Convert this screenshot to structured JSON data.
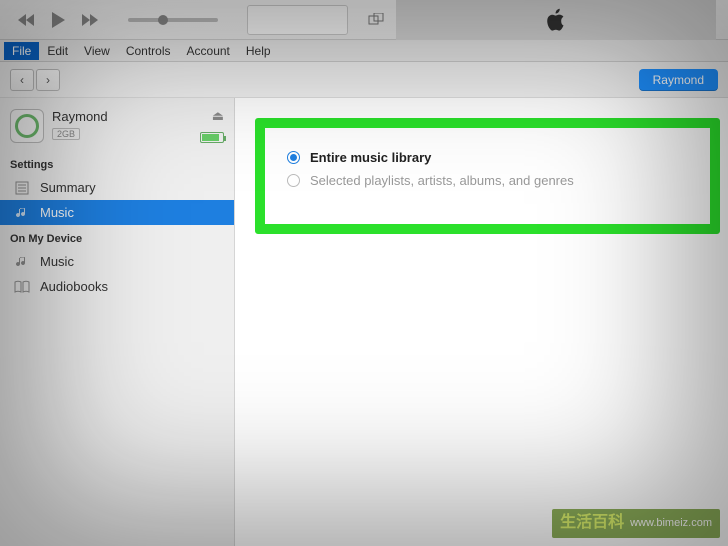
{
  "menubar": {
    "file": "File",
    "edit": "Edit",
    "view": "View",
    "controls": "Controls",
    "account": "Account",
    "help": "Help"
  },
  "nav": {
    "back": "‹",
    "forward": "›",
    "user_button": "Raymond"
  },
  "device": {
    "name": "Raymond",
    "capacity": "2GB",
    "eject_glyph": "⏏"
  },
  "sidebar": {
    "settings_label": "Settings",
    "settings": [
      {
        "icon": "summary-icon",
        "label": "Summary"
      },
      {
        "icon": "music-icon",
        "label": "Music"
      }
    ],
    "ondevice_label": "On My Device",
    "ondevice": [
      {
        "icon": "music-icon",
        "label": "Music"
      },
      {
        "icon": "audiobooks-icon",
        "label": "Audiobooks"
      }
    ]
  },
  "sync": {
    "option_entire": "Entire music library",
    "option_selected": "Selected playlists, artists, albums, and genres"
  },
  "watermark": {
    "line1_cn": "生活百科",
    "line2_url": "www.bimeiz.com"
  },
  "colors": {
    "highlight_border": "#2be02b",
    "accent_blue": "#1e7fe0"
  }
}
